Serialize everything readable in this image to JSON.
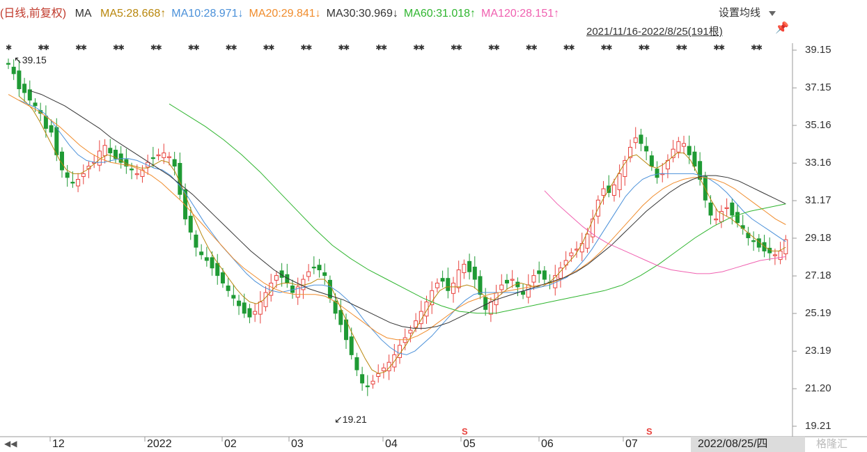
{
  "header": {
    "mode": "(日线,前复权)",
    "ma_label": "MA",
    "ma_items": [
      {
        "label": "MA5:28.668↑",
        "color": "#b8860b"
      },
      {
        "label": "MA10:28.971↓",
        "color": "#4a90d9"
      },
      {
        "label": "MA20:29.841↓",
        "color": "#f08c2c"
      },
      {
        "label": "MA30:30.969↓",
        "color": "#333333"
      },
      {
        "label": "MA60:31.018↑",
        "color": "#2fb52f"
      },
      {
        "label": "MA120:28.151↑",
        "color": "#f060b0"
      }
    ],
    "settings_label": "设置均线",
    "range_label": "2021/11/16-2022/8/25(191根)",
    "pin_icon": "pin-icon"
  },
  "chart_data": {
    "type": "candlestick",
    "yticks": [
      "39.15",
      "37.15",
      "35.16",
      "33.16",
      "31.17",
      "29.18",
      "27.18",
      "25.19",
      "23.19",
      "21.20",
      "19.21"
    ],
    "ylim": [
      19.21,
      39.15
    ],
    "xticks": [
      "12",
      "2022",
      "02",
      "03",
      "04",
      "05",
      "06",
      "07"
    ],
    "current_date_label": "2022/08/25/四",
    "annotations": [
      {
        "text": "39.15",
        "arrow": "↖"
      },
      {
        "text": "19.21",
        "arrow": "↙"
      }
    ],
    "event_marks": [
      "S",
      "S"
    ],
    "colors": {
      "up": "#e8413c",
      "down": "#1f9a34",
      "ma5": "#b8860b",
      "ma10": "#4a90d9",
      "ma20": "#f08c2c",
      "ma30": "#333333",
      "ma60": "#2fb52f",
      "ma120": "#f060b0"
    },
    "closes": [
      38.4,
      37.9,
      37.1,
      36.9,
      36.5,
      36.2,
      35.8,
      35.0,
      34.8,
      33.6,
      32.8,
      32.4,
      32.1,
      32.3,
      32.6,
      33.0,
      33.2,
      33.8,
      34.1,
      33.7,
      33.4,
      33.2,
      33.0,
      32.8,
      32.6,
      32.8,
      33.2,
      33.4,
      33.6,
      33.7,
      33.5,
      33.0,
      31.5,
      30.2,
      29.5,
      28.7,
      28.3,
      28.0,
      27.6,
      27.2,
      26.8,
      26.4,
      26.0,
      25.6,
      25.2,
      25.0,
      25.3,
      25.8,
      26.3,
      26.8,
      27.2,
      27.1,
      26.8,
      26.3,
      26.6,
      27.0,
      27.4,
      27.6,
      27.5,
      27.2,
      26.0,
      25.2,
      24.6,
      23.8,
      23.0,
      22.2,
      21.5,
      21.3,
      21.6,
      22.0,
      22.3,
      22.6,
      23.0,
      23.5,
      23.9,
      24.3,
      24.8,
      25.3,
      25.8,
      26.4,
      26.8,
      26.9,
      26.4,
      26.8,
      27.5,
      27.8,
      27.4,
      27.0,
      26.2,
      25.4,
      25.8,
      26.3,
      26.7,
      26.8,
      27.0,
      26.6,
      26.2,
      26.7,
      27.2,
      27.3,
      27.0,
      26.8,
      27.2,
      27.6,
      28.0,
      28.4,
      28.6,
      28.9,
      29.4,
      30.2,
      31.2,
      31.8,
      31.6,
      32.0,
      32.6,
      33.3,
      34.0,
      34.5,
      34.2,
      33.8,
      33.0,
      32.4,
      32.6,
      33.3,
      33.9,
      34.3,
      34.2,
      33.6,
      33.0,
      32.3,
      31.2,
      30.4,
      30.2,
      30.6,
      30.8,
      30.4,
      30.0,
      29.7,
      29.2,
      29.0,
      28.7,
      28.5,
      28.4,
      28.3,
      28.5,
      29.1
    ],
    "ma5": [
      36.7,
      36.4,
      36.0,
      35.4,
      34.7,
      34.0,
      33.3,
      32.8,
      32.6,
      32.6,
      32.8,
      33.1,
      33.4,
      33.6,
      33.5,
      33.3,
      33.1,
      33.0,
      32.9,
      32.9,
      33.1,
      33.3,
      33.2,
      32.7,
      31.9,
      31.0,
      30.1,
      29.3,
      28.6,
      28.0,
      27.5,
      27.0,
      26.5,
      26.1,
      25.8,
      25.7,
      25.9,
      26.3,
      26.7,
      26.8,
      26.8,
      26.7,
      26.7,
      26.8,
      27.0,
      27.0,
      26.6,
      25.8,
      25.0,
      24.2,
      23.5,
      22.8,
      22.2,
      22.0,
      22.1,
      22.5,
      23.0,
      23.5,
      24.1,
      24.7,
      25.3,
      25.9,
      26.4,
      26.6,
      26.6,
      26.6,
      26.7,
      26.6,
      26.3,
      26.0,
      25.9,
      26.2,
      26.5,
      26.7,
      26.8,
      26.7,
      26.6,
      26.6,
      26.8,
      27.1,
      27.5,
      27.9,
      28.3,
      28.9,
      29.7,
      30.5,
      31.2,
      31.8,
      32.4,
      33.0,
      33.5,
      33.6,
      33.3,
      33.0,
      32.9,
      33.1,
      33.4,
      33.7,
      33.7,
      33.3,
      32.6,
      31.9,
      31.2,
      30.6,
      30.4,
      30.2,
      29.9,
      29.6,
      29.3,
      29.0,
      28.7,
      28.5,
      28.5,
      28.7
    ],
    "ma10": [
      36.5,
      36.3,
      36.1,
      35.8,
      35.3,
      34.7,
      34.1,
      33.6,
      33.3,
      33.2,
      33.2,
      33.3,
      33.4,
      33.4,
      33.3,
      33.1,
      32.9,
      32.8,
      32.5,
      32.0,
      31.4,
      30.7,
      30.0,
      29.4,
      28.8,
      28.3,
      27.8,
      27.3,
      26.9,
      26.6,
      26.4,
      26.3,
      26.4,
      26.5,
      26.6,
      26.7,
      26.7,
      26.6,
      26.3,
      25.9,
      25.4,
      24.8,
      24.3,
      23.8,
      23.4,
      23.1,
      23.0,
      23.2,
      23.6,
      24.0,
      24.5,
      25.0,
      25.5,
      25.9,
      26.2,
      26.3,
      26.3,
      26.3,
      26.3,
      26.3,
      26.4,
      26.5,
      26.6,
      26.7,
      26.9,
      27.1,
      27.5,
      28.0,
      28.6,
      29.3,
      30.0,
      30.7,
      31.4,
      31.9,
      32.3,
      32.5,
      32.6,
      32.6,
      32.6,
      32.6,
      32.6,
      32.5,
      32.3,
      32.0,
      31.6,
      31.1,
      30.6,
      30.2,
      29.9,
      29.6,
      29.3,
      29.0
    ],
    "ma20": [
      36.8,
      36.5,
      36.2,
      35.9,
      35.5,
      35.1,
      34.6,
      34.1,
      33.7,
      33.4,
      33.2,
      33.1,
      33.0,
      32.8,
      32.5,
      32.1,
      31.6,
      31.1,
      30.5,
      29.9,
      29.3,
      28.7,
      28.1,
      27.6,
      27.2,
      26.8,
      26.5,
      26.3,
      26.2,
      26.2,
      26.2,
      26.1,
      25.8,
      25.4,
      25.0,
      24.6,
      24.2,
      23.9,
      23.8,
      23.8,
      24.0,
      24.3,
      24.7,
      25.1,
      25.5,
      25.8,
      26.0,
      26.2,
      26.3,
      26.4,
      26.5,
      26.6,
      26.7,
      26.8,
      27.0,
      27.3,
      27.6,
      28.0,
      28.5,
      29.1,
      29.7,
      30.3,
      30.9,
      31.4,
      31.8,
      32.1,
      32.3,
      32.4,
      32.4,
      32.3,
      32.1,
      31.8,
      31.4,
      31.0,
      30.6,
      30.2,
      29.9
    ],
    "ma30": [
      37.0,
      36.8,
      36.5,
      36.2,
      35.8,
      35.4,
      35.0,
      34.5,
      34.1,
      33.7,
      33.3,
      32.9,
      32.5,
      32.0,
      31.5,
      30.9,
      30.3,
      29.7,
      29.1,
      28.5,
      28.0,
      27.5,
      27.1,
      26.8,
      26.5,
      26.3,
      26.1,
      25.9,
      25.6,
      25.3,
      25.0,
      24.7,
      24.5,
      24.4,
      24.4,
      24.5,
      24.7,
      25.0,
      25.3,
      25.6,
      25.9,
      26.1,
      26.3,
      26.5,
      26.7,
      26.9,
      27.1,
      27.4,
      27.8,
      28.3,
      28.8,
      29.4,
      30.0,
      30.6,
      31.1,
      31.6,
      32.0,
      32.3,
      32.5,
      32.5,
      32.4,
      32.2,
      31.9,
      31.6,
      31.3,
      31.0
    ],
    "ma60": [
      36.3,
      35.7,
      35.1,
      34.4,
      33.6,
      32.7,
      31.7,
      30.7,
      29.7,
      28.8,
      28.1,
      27.5,
      27.0,
      26.5,
      26.0,
      25.6,
      25.3,
      25.2,
      25.2,
      25.4,
      25.6,
      25.8,
      26.0,
      26.2,
      26.4,
      26.7,
      27.2,
      27.8,
      28.5,
      29.2,
      29.8,
      30.3,
      30.6,
      30.8,
      31.0
    ],
    "ma120": [
      31.7,
      31.0,
      30.4,
      29.8,
      29.3,
      28.9,
      28.6,
      28.3,
      28.0,
      27.7,
      27.5,
      27.4,
      27.3,
      27.3,
      27.4,
      27.6,
      27.8,
      28.0,
      28.1,
      28.2
    ]
  },
  "footer": {
    "watermark": "格隆汇"
  }
}
